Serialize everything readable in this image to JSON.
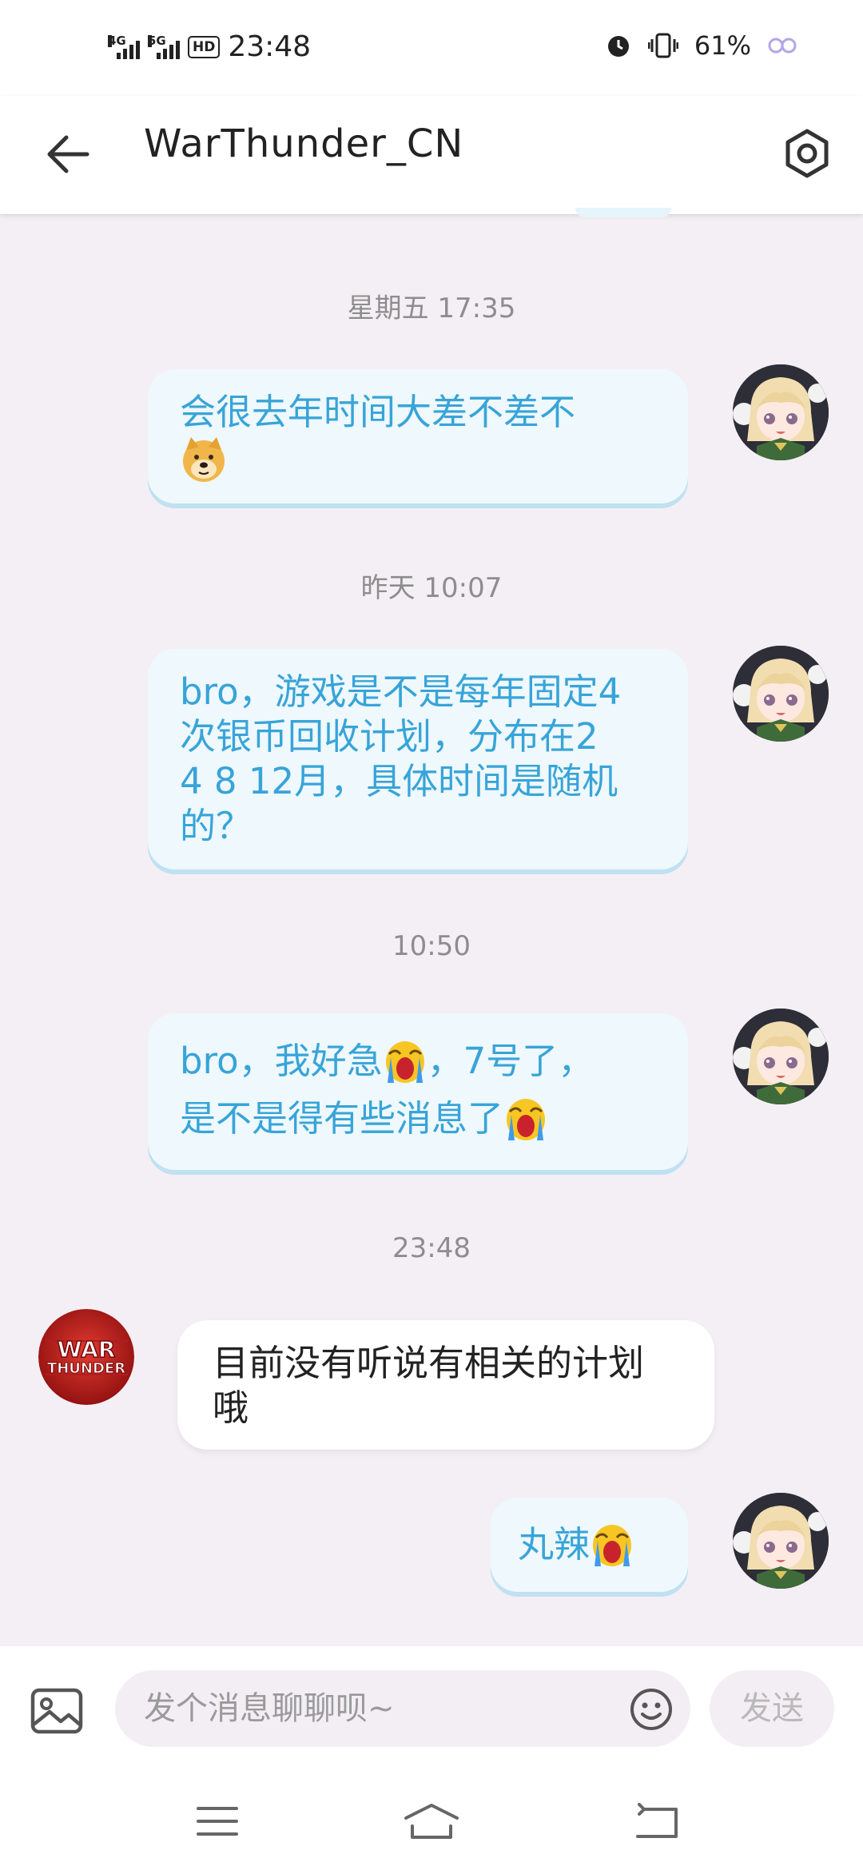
{
  "status_bar": {
    "network_1": "4G",
    "network_2": "5G",
    "hd_badge": "HD",
    "time": "23:48",
    "battery": "61%"
  },
  "header": {
    "title": "WarThunder_CN"
  },
  "icons": {
    "back": "arrow-left-icon",
    "settings": "hexagon-settings-icon",
    "image": "image-icon",
    "emoji": "smiley-icon",
    "menu": "menu-icon",
    "home": "home-icon",
    "return": "return-icon"
  },
  "colors": {
    "outgoing_text": "#38a4d8",
    "outgoing_bubble": "#eef8fd",
    "background": "#f4eff4"
  },
  "messages": [
    {
      "timestamp": "星期五 17:35",
      "direction": "outgoing",
      "text": "会很去年时间大差不差不",
      "emoji": "doge"
    },
    {
      "timestamp": "昨天 10:07",
      "direction": "outgoing",
      "lines": [
        "bro，游戏是不是每年固定4",
        "次银币回收计划，分布在2",
        "4 8 12月，具体时间是随机",
        "的？"
      ]
    },
    {
      "timestamp": "10:50",
      "direction": "outgoing",
      "line1a": "bro，我好急",
      "line1b": "，7号了，",
      "line2": "是不是得有些消息了",
      "emoji": "crying-face"
    },
    {
      "timestamp": "23:48",
      "direction": "incoming",
      "lines": [
        "目前没有听说有相关的计划",
        "哦"
      ],
      "avatar_text": [
        "WAR",
        "THUNDER"
      ]
    },
    {
      "direction": "outgoing",
      "text": "丸辣",
      "emoji": "crying-face"
    }
  ],
  "input": {
    "placeholder": "发个消息聊聊呗~",
    "send_label": "发送"
  }
}
